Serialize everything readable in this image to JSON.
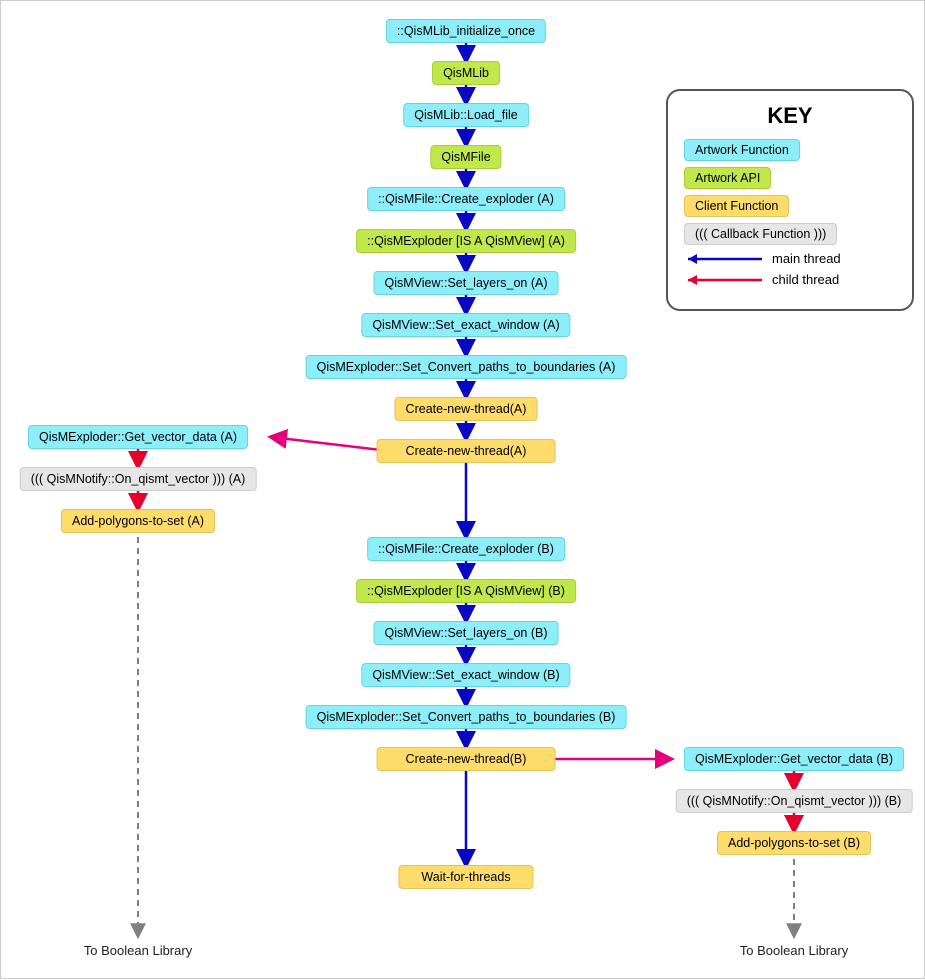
{
  "nodes": {
    "n1": "::QisMLib_initialize_once",
    "n2": "QisMLib",
    "n3": "QisMLib::Load_file",
    "n4": "QisMFile",
    "n5": "::QisMFile::Create_exploder (A)",
    "n6": "::QisMExploder [IS A QisMView] (A)",
    "n7": "QisMView::Set_layers_on (A)",
    "n8": "QisMView::Set_exact_window (A)",
    "n9": "QisMExploder::Set_Convert_paths_to_boundaries (A)",
    "n10": "Create-new-thread(A)",
    "a1": "QisMExploder::Get_vector_data (A)",
    "a2": "((( QisMNotify::On_qismt_vector )))  (A)",
    "a3": "Add-polygons-to-set (A)",
    "n11": "::QisMFile::Create_exploder (B)",
    "n12": "::QisMExploder [IS A QisMView] (B)",
    "n13": "QisMView::Set_layers_on (B)",
    "n14": "QisMView::Set_exact_window (B)",
    "n15": "QisMExploder::Set_Convert_paths_to_boundaries (B)",
    "n16": "Create-new-thread(B)",
    "b1": "QisMExploder::Get_vector_data (B)",
    "b2": "((( QisMNotify::On_qismt_vector )))  (B)",
    "b3": "Add-polygons-to-set (B)",
    "n17": "Wait-for-threads"
  },
  "labels": {
    "out_left": "To Boolean Library",
    "out_right": "To Boolean Library"
  },
  "key": {
    "title": "KEY",
    "artwork_function": "Artwork Function",
    "artwork_api": "Artwork API",
    "client_function": "Client Function",
    "callback_function": "((( Callback Function )))",
    "main_thread": "main thread",
    "child_thread": "child thread"
  },
  "colors": {
    "cyan": "#8ceef9",
    "lime": "#c0e84a",
    "amber": "#fddc6b",
    "gray": "#e6e6e6",
    "blue": "#0a07c2",
    "red": "#e4002b",
    "magenta": "#e6007e",
    "dash": "#808080"
  }
}
